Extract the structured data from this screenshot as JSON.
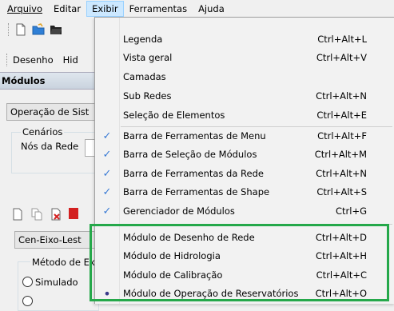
{
  "menubar": {
    "items": [
      {
        "label": "Arquivo"
      },
      {
        "label": "Editar"
      },
      {
        "label": "Exibir"
      },
      {
        "label": "Ferramentas"
      },
      {
        "label": "Ajuda"
      }
    ]
  },
  "toolbar2": {
    "desenho": "Desenho",
    "hid": "Hid"
  },
  "panel": {
    "title": "Módulos",
    "operation_combo": "Operação de Sist",
    "scenarios_group": "Cenários",
    "nodes_label": "Nós da Rede",
    "scenario_combo": "Cen-Eixo-Lest",
    "method_group": "Método de Ex",
    "radio_simulado": "Simulado"
  },
  "menu": {
    "items": [
      {
        "label": "Legenda",
        "shortcut": "Ctrl+Alt+L",
        "mark": ""
      },
      {
        "label": "Vista geral",
        "shortcut": "Ctrl+Alt+V",
        "mark": ""
      },
      {
        "label": "Camadas",
        "shortcut": "",
        "mark": ""
      },
      {
        "label": "Sub Redes",
        "shortcut": "Ctrl+Alt+N",
        "mark": ""
      },
      {
        "label": "Seleção de Elementos",
        "shortcut": "Ctrl+Alt+E",
        "mark": ""
      },
      {
        "label": "Barra de Ferramentas de Menu",
        "shortcut": "Ctrl+Alt+F",
        "mark": "check"
      },
      {
        "label": "Barra de Seleção de Módulos",
        "shortcut": "Ctrl+Alt+M",
        "mark": "check"
      },
      {
        "label": "Barra de Ferramentas da Rede",
        "shortcut": "Ctrl+Alt+N",
        "mark": "check"
      },
      {
        "label": "Barra de Ferramentas de Shape",
        "shortcut": "Ctrl+Alt+S",
        "mark": "check"
      },
      {
        "label": "Gerenciador de Módulos",
        "shortcut": "Ctrl+G",
        "mark": "check"
      },
      {
        "label": "Módulo de Desenho de Rede",
        "shortcut": "Ctrl+Alt+D",
        "mark": ""
      },
      {
        "label": "Módulo de Hidrologia",
        "shortcut": "Ctrl+Alt+H",
        "mark": ""
      },
      {
        "label": "Módulo de Calibração",
        "shortcut": "Ctrl+Alt+C",
        "mark": ""
      },
      {
        "label": "Módulo de Operação de Reservatórios",
        "shortcut": "Ctrl+Alt+O",
        "mark": "bullet"
      }
    ]
  },
  "colors": {
    "check": "#3a7bd5",
    "highlight": "#25a84a",
    "menu_active": "#cce8ff"
  }
}
